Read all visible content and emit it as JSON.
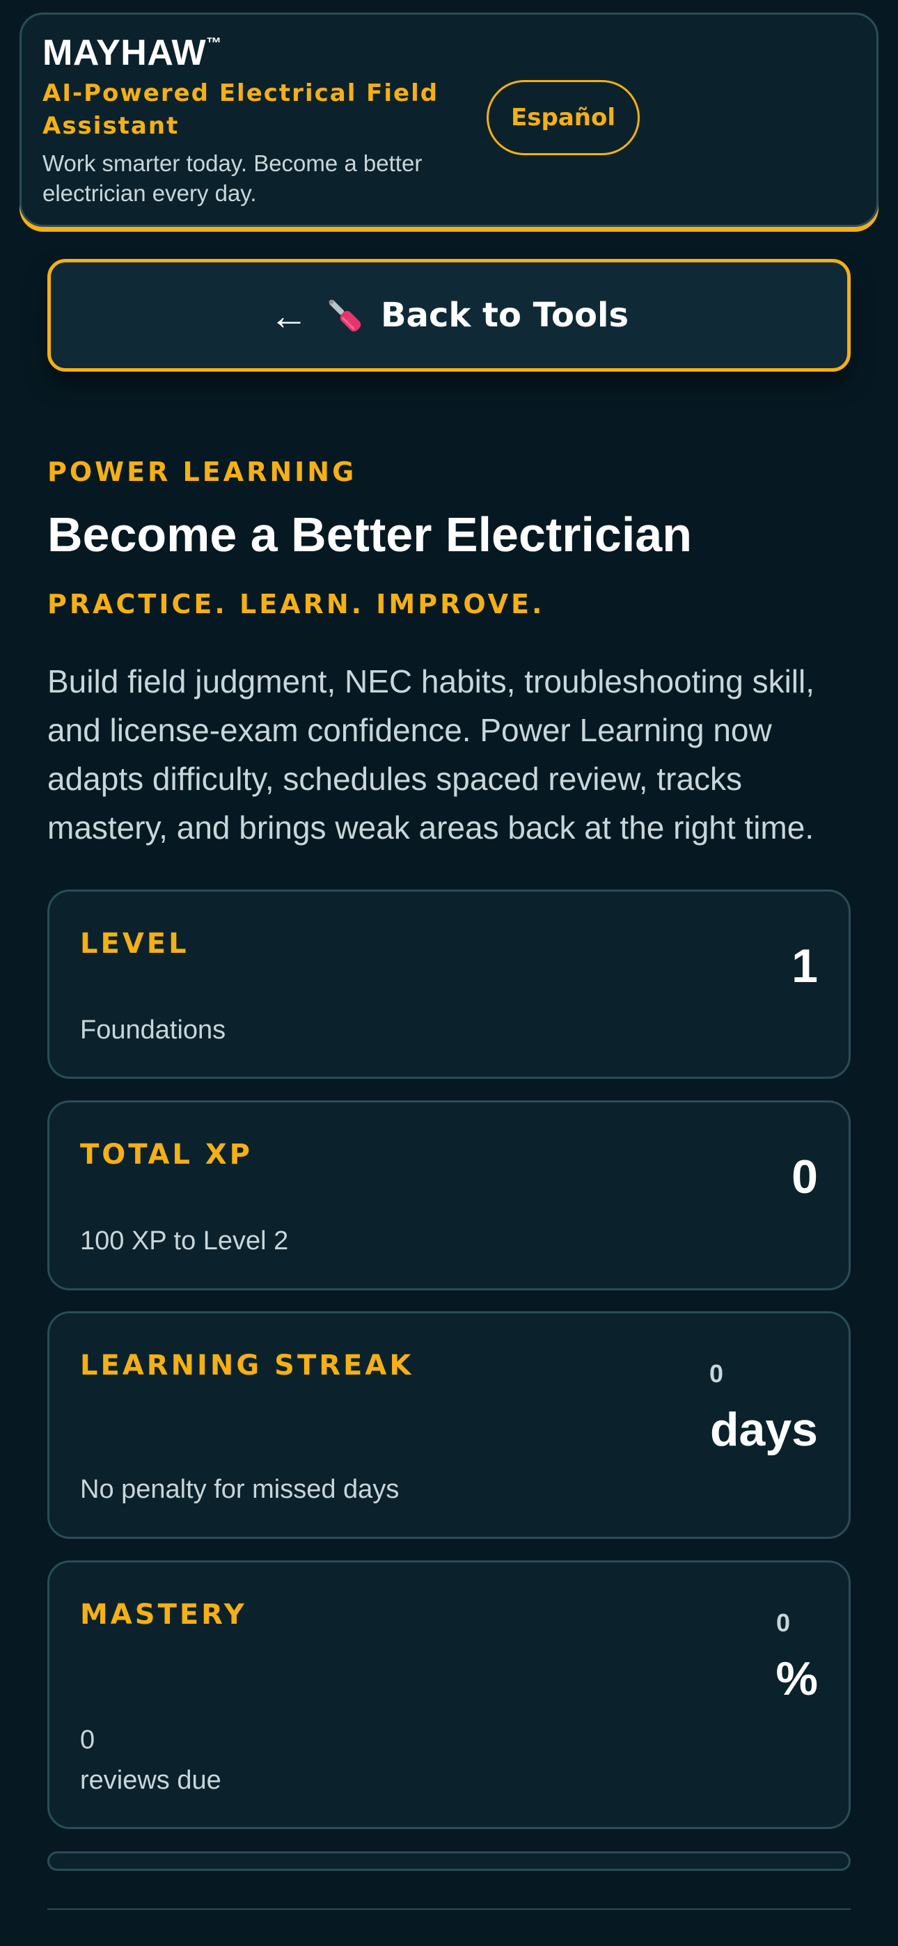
{
  "header": {
    "brand": "MAYHAW",
    "trademark": "™",
    "tagline": "AI-Powered Electrical Field Assistant",
    "subtitle": "Work smarter today. Become a better electrician every day.",
    "language_button": "Español"
  },
  "back_button": {
    "arrow": "←",
    "icon": "screwdriver-icon",
    "label": "Back to Tools"
  },
  "section": {
    "eyebrow": "POWER LEARNING",
    "title": "Become a Better Electrician",
    "motto": "PRACTICE. LEARN. IMPROVE.",
    "description": "Build field judgment, NEC habits, troubleshooting skill, and license-exam confidence. Power Learning now adapts difficulty, schedules spaced review, tracks mastery, and brings weak areas back at the right time."
  },
  "stats": {
    "level": {
      "label": "LEVEL",
      "value": "1",
      "note": "Foundations"
    },
    "xp": {
      "label": "TOTAL XP",
      "value": "0",
      "note": "100 XP to Level 2"
    },
    "streak": {
      "label": "LEARNING STREAK",
      "value": "0",
      "unit": "days",
      "note": "No penalty for missed days"
    },
    "mastery": {
      "label": "MASTERY",
      "value": "0",
      "unit": "%",
      "reviews_count": "0",
      "reviews_label": "reviews due"
    }
  },
  "colors": {
    "accent": "#f5b014",
    "background": "#061922",
    "card": "#0b222c",
    "border": "#2b4c58"
  }
}
